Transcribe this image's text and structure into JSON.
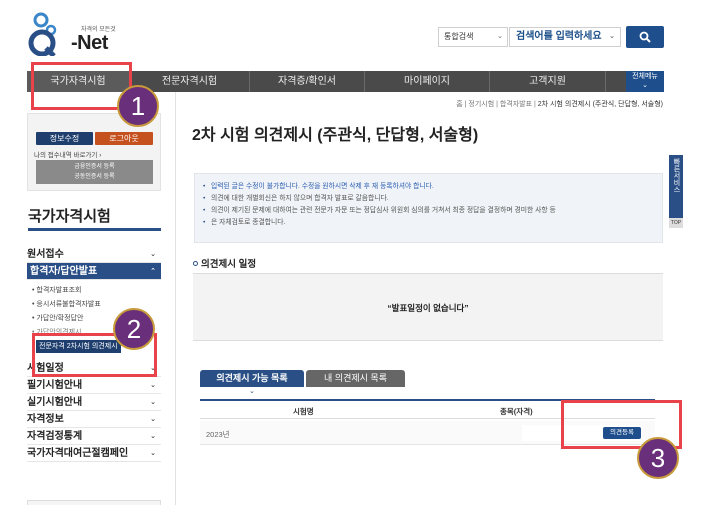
{
  "header": {
    "logo_small": "자격의 모든것",
    "logo_text": "Q-Net",
    "search_scope": "통합검색",
    "search_placeholder": "검색어를 입력하세요"
  },
  "gnb": {
    "items": [
      "국가자격시험",
      "전문자격시험",
      "자격증/확인서",
      "마이페이지",
      "고객지원"
    ],
    "all_menu": "전체메뉴"
  },
  "breadcrumb": {
    "path": "홈 | 정기시험 | 합격자발표 | ",
    "current": "2차 시험 의견제시 (주관식, 단답형, 서술형)"
  },
  "login_box": {
    "info_button": "정보수정",
    "logout_button": "로그아웃",
    "recent_text": "나의 접수내역 바로가기 ›",
    "cert_line1": "금융인증서 등록",
    "cert_line2": "공동인증서 등록"
  },
  "sidebar": {
    "title": "국가자격시험",
    "items": [
      {
        "label": "원서접수"
      },
      {
        "label": "합격자/답안발표"
      },
      {
        "label": "시험일정"
      },
      {
        "label": "필기시험안내"
      },
      {
        "label": "실기시험안내"
      },
      {
        "label": "자격정보"
      },
      {
        "label": "자격검정통계"
      },
      {
        "label": "국가자격대여근절캠페인"
      }
    ],
    "sub_items": [
      "합격자발표조회",
      "응시서류불합격자발표",
      "가답안/확정답안",
      "가답안의견제시",
      "전문자격 2차시험 의견제시"
    ]
  },
  "main": {
    "title": "2차 시험 의견제시 (주관식, 단답형, 서술형)",
    "notices": [
      "입력된 글은 수정이 불가합니다. 수정을 원하시면 삭제 후 재 등록하셔야 합니다.",
      "의견에 대한 개별회신은 하지 않으며 합격자 발표로 갈음합니다.",
      "의견이 제기된 문제에 대하여는 관련 전문가 자문 또는 정답심사 위원회 심의를 거쳐서 최종 정답을 결정하며 경미한 사항 등",
      "은 자체검토로 종결합니다."
    ],
    "schedule_heading": "의견제시 일정",
    "schedule_message": "“발표일정이 없습니다”",
    "tabs": [
      "의견제시 가능 목록",
      "내 의견제시 목록"
    ],
    "table_headers": [
      "시험명",
      "종목(자격)"
    ],
    "rows": [
      {
        "name": "2023년",
        "button": "의견등록"
      }
    ],
    "quick_menu": "빠른서비스",
    "top_label": "TOP"
  },
  "annotations": [
    "1",
    "2",
    "3"
  ],
  "colors": {
    "brand": "#1e4f8c",
    "nav_bg": "#4a4a4a",
    "highlight": "#e8434b",
    "badge": "#6a2f7a",
    "logout": "#c5511f"
  }
}
